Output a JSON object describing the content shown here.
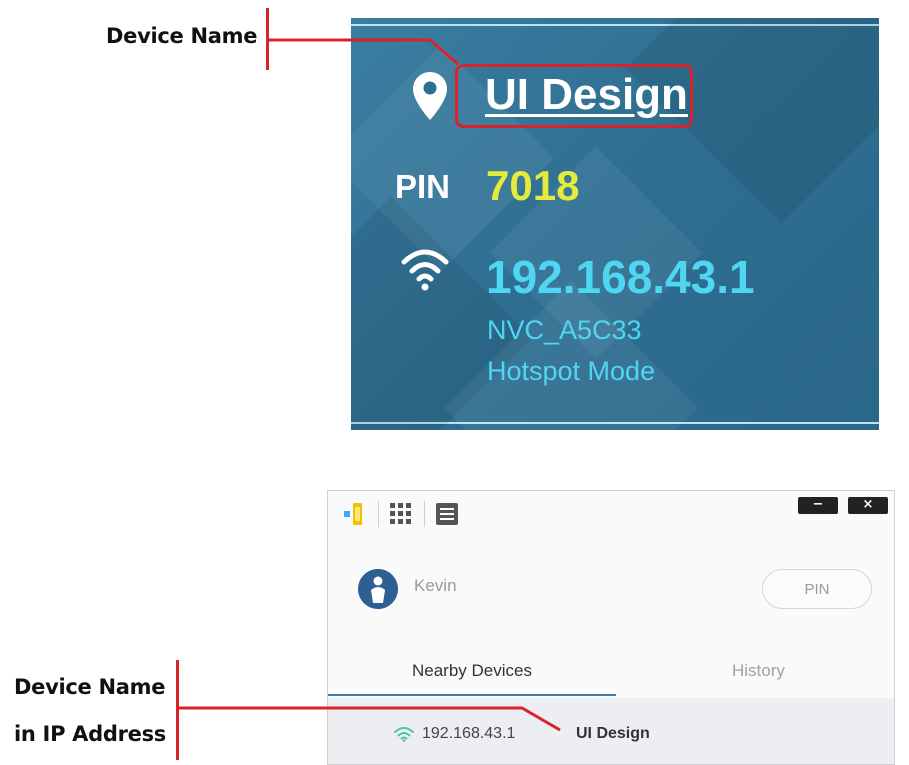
{
  "annotations": {
    "top_label": "Device Name",
    "bottom_label_line1": "Device Name",
    "bottom_label_line2": "in IP Address",
    "accent_color": "#d8232a"
  },
  "device_screen": {
    "device_name": "UI Design",
    "pin_label": "PIN",
    "pin_value": "7018",
    "ip_address": "192.168.43.1",
    "ssid": "NVC_A5C33",
    "mode": "Hotspot Mode",
    "icons": [
      "location-pin-icon",
      "wifi-icon"
    ],
    "colors": {
      "background": "#2f6f92",
      "pin": "#e3ec3a",
      "ip": "#4fd6f2"
    }
  },
  "app_window": {
    "toolbar_icons": [
      "app-logo-icon",
      "grid-icon",
      "list-icon"
    ],
    "window_controls": {
      "minimize": "−",
      "close": "×"
    },
    "user_name": "Kevin",
    "pin_button": "PIN",
    "tabs": [
      {
        "label": "Nearby Devices",
        "active": true
      },
      {
        "label": "History",
        "active": false
      }
    ],
    "devices": [
      {
        "ip": "192.168.43.1",
        "name": "UI Design",
        "icon": "wifi-icon"
      }
    ],
    "colors": {
      "tab_indicator": "#4277a8",
      "wifi": "#4fc39a"
    }
  }
}
